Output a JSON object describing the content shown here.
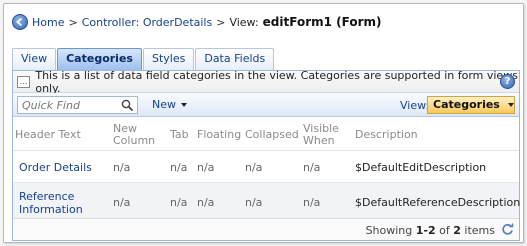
{
  "breadcrumb": {
    "home": "Home",
    "sep1": ">",
    "controller": "Controller: OrderDetails",
    "sep2": ">",
    "view_prefix": "View:",
    "current": "editForm1 (Form)"
  },
  "tabs": [
    {
      "label": "View",
      "active": false
    },
    {
      "label": "Categories",
      "active": true
    },
    {
      "label": "Styles",
      "active": false
    },
    {
      "label": "Data Fields",
      "active": false
    }
  ],
  "description": "This is a list of data field categories in the view. Categories are supported in form views only.",
  "toolbar": {
    "quick_find_placeholder": "Quick Find",
    "new_label": "New",
    "view_label": "View:",
    "view_value": "Categories"
  },
  "columns": [
    "Header Text",
    "New Column",
    "Tab",
    "Floating",
    "Collapsed",
    "Visible When",
    "Description"
  ],
  "column_lines": {
    "new_column": [
      "New",
      "Column"
    ],
    "visible_when": [
      "Visible",
      "When"
    ]
  },
  "rows": [
    {
      "header_text": [
        "Order Details"
      ],
      "new_column": "n/a",
      "tab": "n/a",
      "floating": "n/a",
      "collapsed": "n/a",
      "visible_when": "n/a",
      "description": "$DefaultEditDescription"
    },
    {
      "header_text": [
        "Reference",
        "Information"
      ],
      "new_column": "n/a",
      "tab": "n/a",
      "floating": "n/a",
      "collapsed": "n/a",
      "visible_when": "n/a",
      "description": "$DefaultReferenceDescription"
    }
  ],
  "pager": {
    "showing": "Showing",
    "range": "1-2",
    "of": "of",
    "total": "2",
    "items": "items"
  },
  "colors": {
    "link": "#15428b",
    "active_tab": "#9cc0ee",
    "view_selector": "#f9c85a"
  },
  "icons": [
    "back-arrow-icon",
    "note-icon",
    "help-icon",
    "search-icon",
    "dropdown-arrow-icon",
    "refresh-icon"
  ]
}
